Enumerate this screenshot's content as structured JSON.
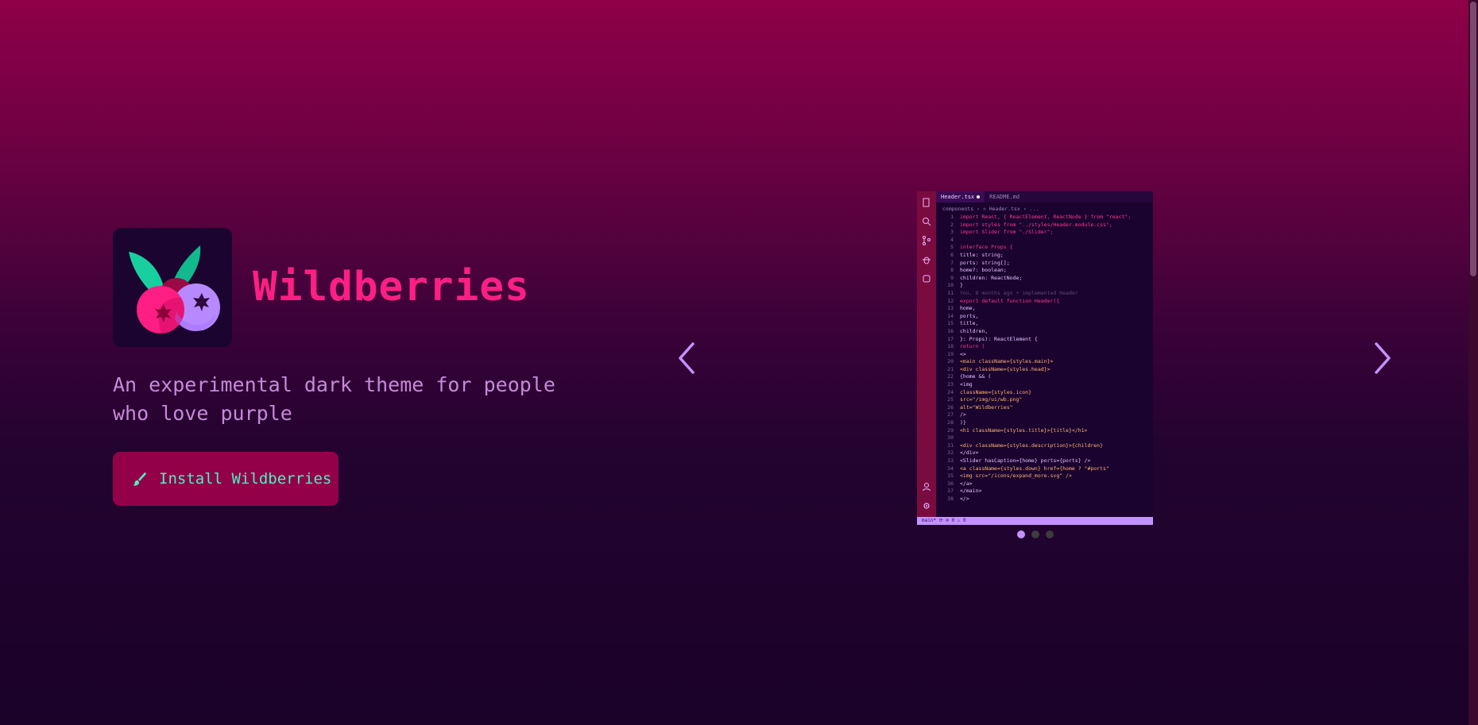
{
  "hero": {
    "title": "Wildberries",
    "tagline": "An experimental dark theme for people who love purple",
    "install_label": "Install Wildberries"
  },
  "carousel": {
    "active_index": 0,
    "slide_count": 3,
    "editor": {
      "tabs": [
        {
          "label": "Header.tsx"
        },
        {
          "label": "README.md"
        }
      ],
      "breadcrumb": "components › ⚛ Header.tsx › ...",
      "status": "main* ⟳ ⊗ 0 ⚠ 0",
      "lines": [
        {
          "n": "1",
          "t": "import React, { ReactElement, ReactNode } from \"react\";"
        },
        {
          "n": "2",
          "t": "import styles from \"../styles/Header.module.css\";"
        },
        {
          "n": "3",
          "t": "import Slider from \"./Slider\";"
        },
        {
          "n": "4",
          "t": ""
        },
        {
          "n": "5",
          "t": "interface Props {"
        },
        {
          "n": "6",
          "t": "  title: string;"
        },
        {
          "n": "7",
          "t": "  ports: string[];"
        },
        {
          "n": "8",
          "t": "  home?: boolean;"
        },
        {
          "n": "9",
          "t": "  children: ReactNode;"
        },
        {
          "n": "10",
          "t": "}"
        },
        {
          "n": "11",
          "t": "     You, 8 months ago • implemented Header"
        },
        {
          "n": "12",
          "t": "export default function Header({"
        },
        {
          "n": "13",
          "t": "  home,"
        },
        {
          "n": "14",
          "t": "  ports,"
        },
        {
          "n": "15",
          "t": "  title,"
        },
        {
          "n": "16",
          "t": "  children,"
        },
        {
          "n": "17",
          "t": "}: Props): ReactElement {"
        },
        {
          "n": "18",
          "t": "  return ("
        },
        {
          "n": "19",
          "t": "    <>"
        },
        {
          "n": "20",
          "t": "      <main className={styles.main}>"
        },
        {
          "n": "21",
          "t": "        <div className={styles.head}>"
        },
        {
          "n": "22",
          "t": "          {home && ("
        },
        {
          "n": "23",
          "t": "            <img"
        },
        {
          "n": "24",
          "t": "              className={styles.icon}"
        },
        {
          "n": "25",
          "t": "              src=\"/img/ui/wb.png\""
        },
        {
          "n": "26",
          "t": "              alt=\"Wildberries\""
        },
        {
          "n": "27",
          "t": "            />"
        },
        {
          "n": "28",
          "t": "          )}"
        },
        {
          "n": "29",
          "t": "          <h1 className={styles.title}>{title}</h1>"
        },
        {
          "n": "30",
          "t": ""
        },
        {
          "n": "31",
          "t": "          <div className={styles.description}>{children}"
        },
        {
          "n": "32",
          "t": "        </div>"
        },
        {
          "n": "33",
          "t": "        <Slider hasCaption={home} ports={ports} />"
        },
        {
          "n": "34",
          "t": "        <a className={styles.down} href={home ? \"#ports\""
        },
        {
          "n": "35",
          "t": "          <img src=\"/icons/expand_more.svg\" />"
        },
        {
          "n": "36",
          "t": "        </a>"
        },
        {
          "n": "37",
          "t": "      </main>"
        },
        {
          "n": "38",
          "t": "    </>"
        }
      ]
    }
  },
  "colors": {
    "title": "#ff1f84",
    "tagline": "#c68ad8",
    "button_bg": "#930049",
    "button_text": "#4bf0c4",
    "accent_purple": "#c392ff"
  },
  "icons": {
    "install": "paintbrush-icon",
    "prev": "chevron-left-icon",
    "next": "chevron-right-icon"
  }
}
